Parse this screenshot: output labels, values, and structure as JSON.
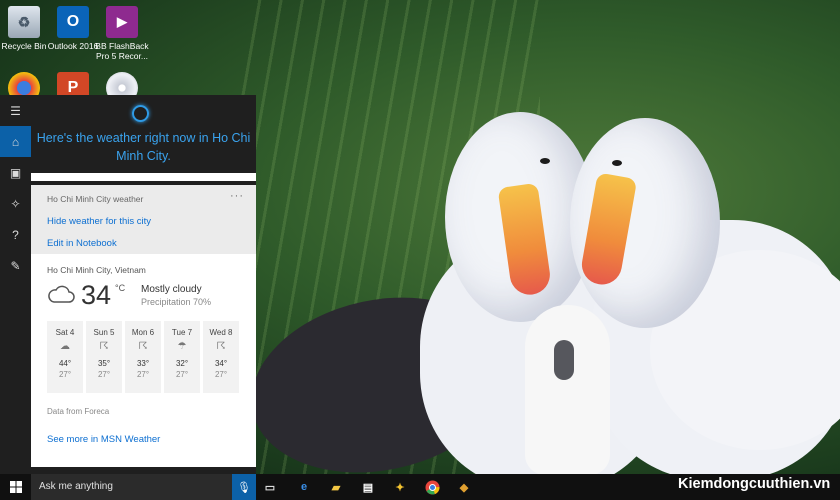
{
  "desktop_icons": [
    {
      "label": "Recycle Bin",
      "icon": "recycle-bin-icon"
    },
    {
      "label": "Outlook 2016",
      "icon": "outlook-icon"
    },
    {
      "label": "BB FlashBack Pro 5 Recor...",
      "icon": "flashback-recorder-icon"
    }
  ],
  "cortana": {
    "greeting": "Here's the weather right now in Ho Chi Minh City.",
    "card": {
      "title": "Ho Chi Minh City weather",
      "more": "···",
      "hide_link": "Hide weather for this city",
      "notebook_link": "Edit in Notebook",
      "location": "Ho Chi Minh City, Vietnam",
      "temperature": "34",
      "unit": "°C",
      "condition": "Mostly cloudy",
      "precipitation": "Precipitation 70%",
      "forecast": [
        {
          "day": "Sat 4",
          "high": "44°",
          "low": "27°",
          "icon": "cloud-icon"
        },
        {
          "day": "Sun 5",
          "high": "35°",
          "low": "27°",
          "icon": "thunderstorm-icon"
        },
        {
          "day": "Mon 6",
          "high": "33°",
          "low": "27°",
          "icon": "thunderstorm-icon"
        },
        {
          "day": "Tue 7",
          "high": "32°",
          "low": "27°",
          "icon": "rain-cloud-icon"
        },
        {
          "day": "Wed 8",
          "high": "34°",
          "low": "27°",
          "icon": "thunderstorm-icon"
        }
      ],
      "source": "Data from Foreca",
      "msn_link": "See more in MSN Weather"
    }
  },
  "taskbar": {
    "search_placeholder": "Ask me anything"
  },
  "watermark": "Kiemdongcuuthien.vn",
  "colors": {
    "accent": "#0c61a8",
    "cortana_blue": "#3aa3ee",
    "link": "#0d6fd1"
  }
}
